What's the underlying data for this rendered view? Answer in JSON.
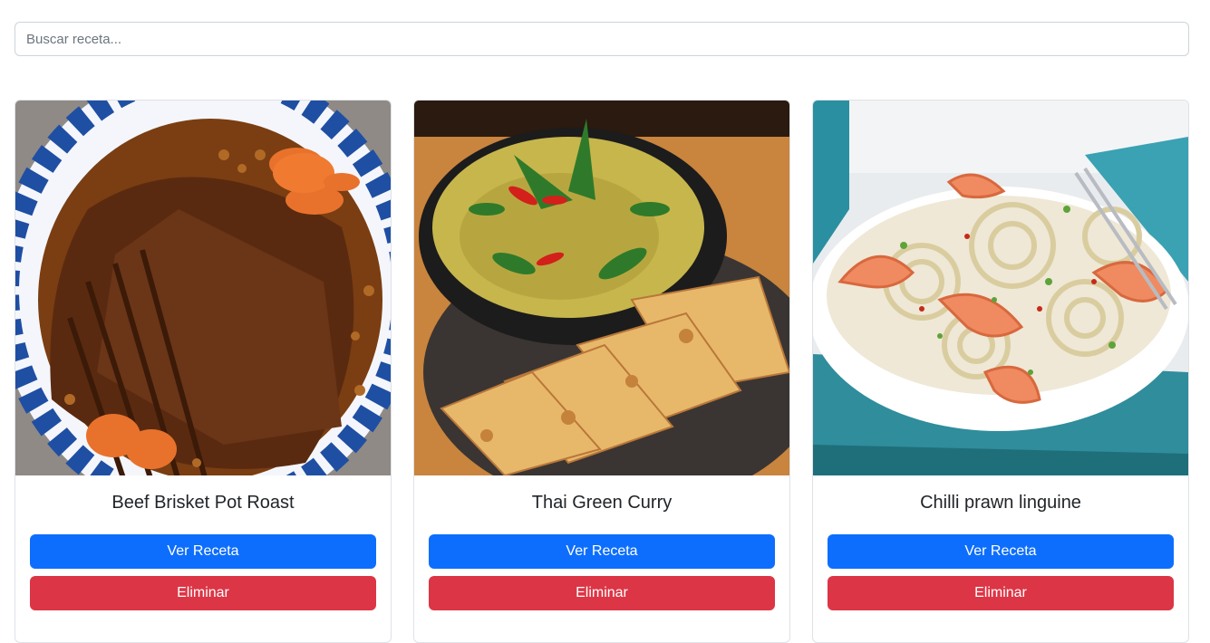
{
  "search": {
    "placeholder": "Buscar receta..."
  },
  "colors": {
    "primary": "#0d6efd",
    "danger": "#dc3545"
  },
  "recipes": [
    {
      "title": "Beef Brisket Pot Roast",
      "view_label": "Ver Receta",
      "delete_label": "Eliminar"
    },
    {
      "title": "Thai Green Curry",
      "view_label": "Ver Receta",
      "delete_label": "Eliminar"
    },
    {
      "title": "Chilli prawn linguine",
      "view_label": "Ver Receta",
      "delete_label": "Eliminar"
    }
  ]
}
